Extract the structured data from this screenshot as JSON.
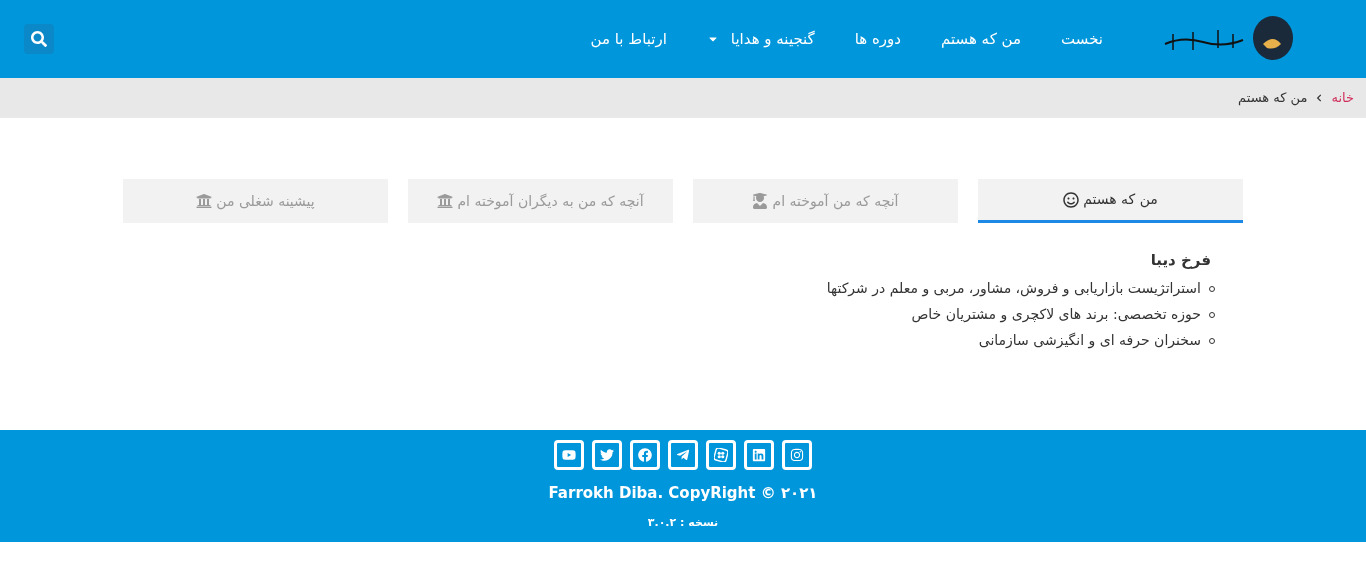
{
  "nav": {
    "items": [
      {
        "label": "نخست",
        "has_dropdown": false
      },
      {
        "label": "من که هستم",
        "has_dropdown": false
      },
      {
        "label": "دوره ها",
        "has_dropdown": false
      },
      {
        "label": "گنجینه و هدایا",
        "has_dropdown": true
      },
      {
        "label": "ارتباط با من",
        "has_dropdown": false
      }
    ]
  },
  "breadcrumb": {
    "home": "خانه",
    "current": "من که هستم"
  },
  "tabs": [
    {
      "label": "من که هستم",
      "selected": true
    },
    {
      "label": "آنچه که من آموخته ام",
      "selected": false
    },
    {
      "label": "آنچه که من به دیگران آموخته ام",
      "selected": false
    },
    {
      "label": "پیشینه شغلی من",
      "selected": false
    }
  ],
  "content": {
    "heading": "فرخ دیبا",
    "items": [
      "استراتژیست بازاریابی و فروش، مشاور، مربی و معلم در شرکتها",
      "حوزه تخصصی: برند های لاکچری و مشتریان خاص",
      "سخنران حرفه ای و انگیزشی سازمانی"
    ]
  },
  "footer": {
    "copyright": "Farrokh Diba. CopyRight © ۲۰۲۱",
    "version": "نسخه : ۳.۰.۲"
  }
}
